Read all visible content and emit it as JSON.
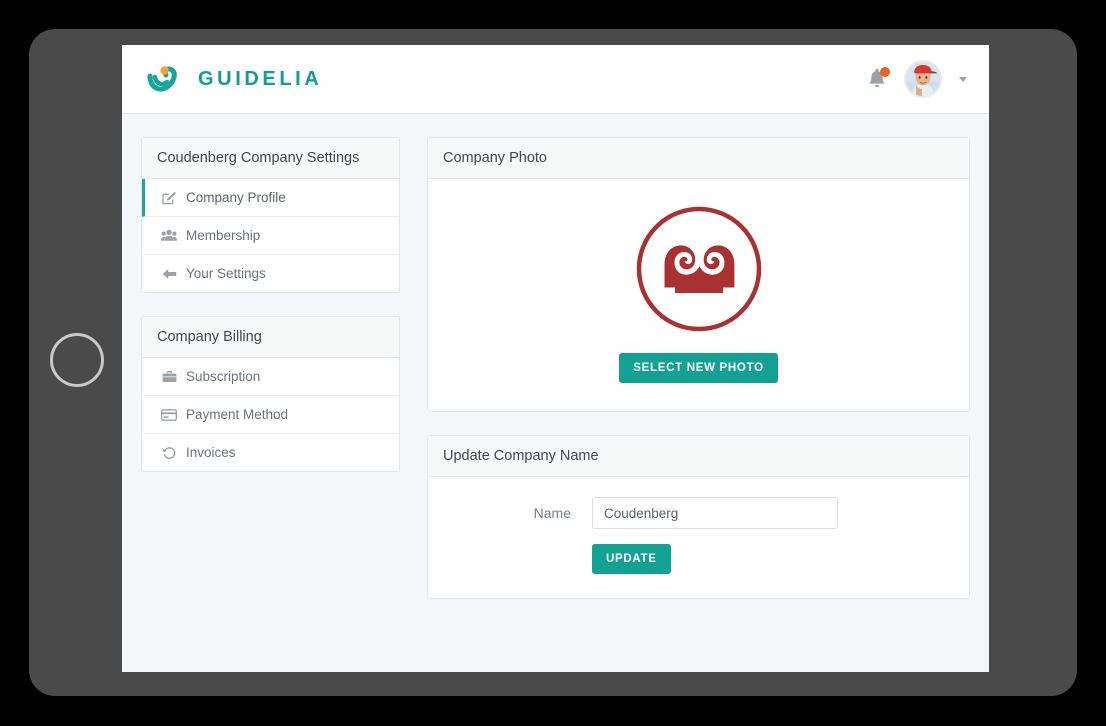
{
  "brand": {
    "name": "GUIDELIA",
    "logo_icon": "guidelia-swoosh-logo",
    "color": "#119d96",
    "accent_dot_color": "#f3a33a"
  },
  "header": {
    "notifications_icon": "bell-icon",
    "notification_badge_color": "#e8622c",
    "avatar_icon": "user-avatar-photo",
    "account_caret_icon": "chevron-down-icon"
  },
  "sidebar": {
    "settings_panel": {
      "title": "Coudenberg Company Settings",
      "items": [
        {
          "label": "Company Profile",
          "icon": "edit-pencil-icon",
          "active": true
        },
        {
          "label": "Membership",
          "icon": "users-group-icon",
          "active": false
        },
        {
          "label": "Your Settings",
          "icon": "arrow-left-icon",
          "active": false
        }
      ]
    },
    "billing_panel": {
      "title": "Company Billing",
      "items": [
        {
          "label": "Subscription",
          "icon": "briefcase-icon",
          "active": false
        },
        {
          "label": "Payment Method",
          "icon": "credit-card-icon",
          "active": false
        },
        {
          "label": "Invoices",
          "icon": "history-clock-icon",
          "active": false
        }
      ]
    },
    "active_accent_color": "#16a79d"
  },
  "main": {
    "photo_card": {
      "title": "Company Photo",
      "logo_icon": "coudenberg-crown-emblem",
      "logo_color": "#a83232",
      "select_photo_label": "SELECT NEW PHOTO"
    },
    "name_card": {
      "title": "Update Company Name",
      "name_label": "Name",
      "name_value": "Coudenberg",
      "name_placeholder": "Company name",
      "update_label": "UPDATE"
    },
    "button_color": "#13a193"
  },
  "device": {
    "home_button_icon": "home-button"
  }
}
